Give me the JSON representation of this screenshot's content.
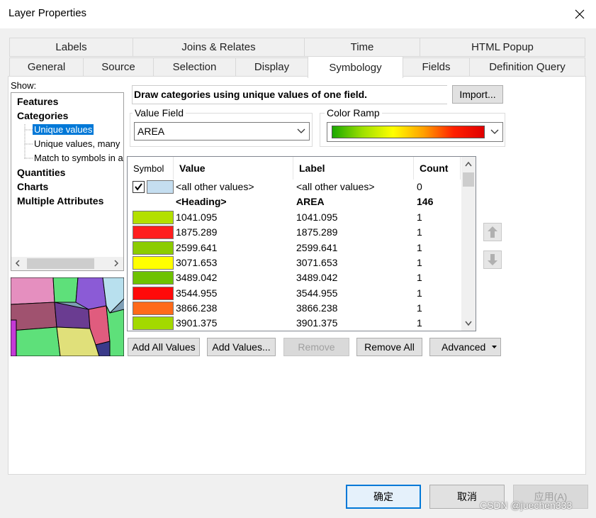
{
  "window": {
    "title": "Layer Properties"
  },
  "tabs_top": [
    "Labels",
    "Joins & Relates",
    "Time",
    "HTML Popup"
  ],
  "tabs_bottom": [
    "General",
    "Source",
    "Selection",
    "Display",
    "Symbology",
    "Fields",
    "Definition Query"
  ],
  "show": {
    "label": "Show:",
    "items": [
      "Features",
      "Categories",
      "Unique values",
      "Unique values, many",
      "Match to symbols in a",
      "Quantities",
      "Charts",
      "Multiple Attributes"
    ]
  },
  "description": "Draw categories using unique values of one field.",
  "import_label": "Import...",
  "value_field": {
    "label": "Value Field",
    "value": "AREA"
  },
  "color_ramp": {
    "label": "Color Ramp"
  },
  "table": {
    "headers": [
      "Symbol",
      "Value",
      "Label",
      "Count"
    ],
    "all_other": {
      "value": "<all other values>",
      "label": "<all other values>",
      "count": "0",
      "color": "#c5def0"
    },
    "heading": {
      "value": "<Heading>",
      "label": "AREA",
      "count": "146"
    },
    "rows": [
      {
        "color": "#b3e000",
        "value": "1041.095",
        "label": "1041.095",
        "count": "1"
      },
      {
        "color": "#ff1e1e",
        "value": "1875.289",
        "label": "1875.289",
        "count": "1"
      },
      {
        "color": "#8ccc00",
        "value": "2599.641",
        "label": "2599.641",
        "count": "1"
      },
      {
        "color": "#ffff00",
        "value": "3071.653",
        "label": "3071.653",
        "count": "1"
      },
      {
        "color": "#6ec200",
        "value": "3489.042",
        "label": "3489.042",
        "count": "1"
      },
      {
        "color": "#ff0a0a",
        "value": "3544.955",
        "label": "3544.955",
        "count": "1"
      },
      {
        "color": "#ff6a1a",
        "value": "3866.238",
        "label": "3866.238",
        "count": "1"
      },
      {
        "color": "#a3d900",
        "value": "3901.375",
        "label": "3901.375",
        "count": "1"
      }
    ]
  },
  "buttons": {
    "add_all": "Add All Values",
    "add_values": "Add Values...",
    "remove": "Remove",
    "remove_all": "Remove All",
    "advanced": "Advanced",
    "ok": "确定",
    "cancel": "取消",
    "apply": "应用(A)"
  },
  "watermark": "CSDN @juechen333",
  "colors": {
    "selection": "#0078d7",
    "accent_border": "#0078d7"
  }
}
